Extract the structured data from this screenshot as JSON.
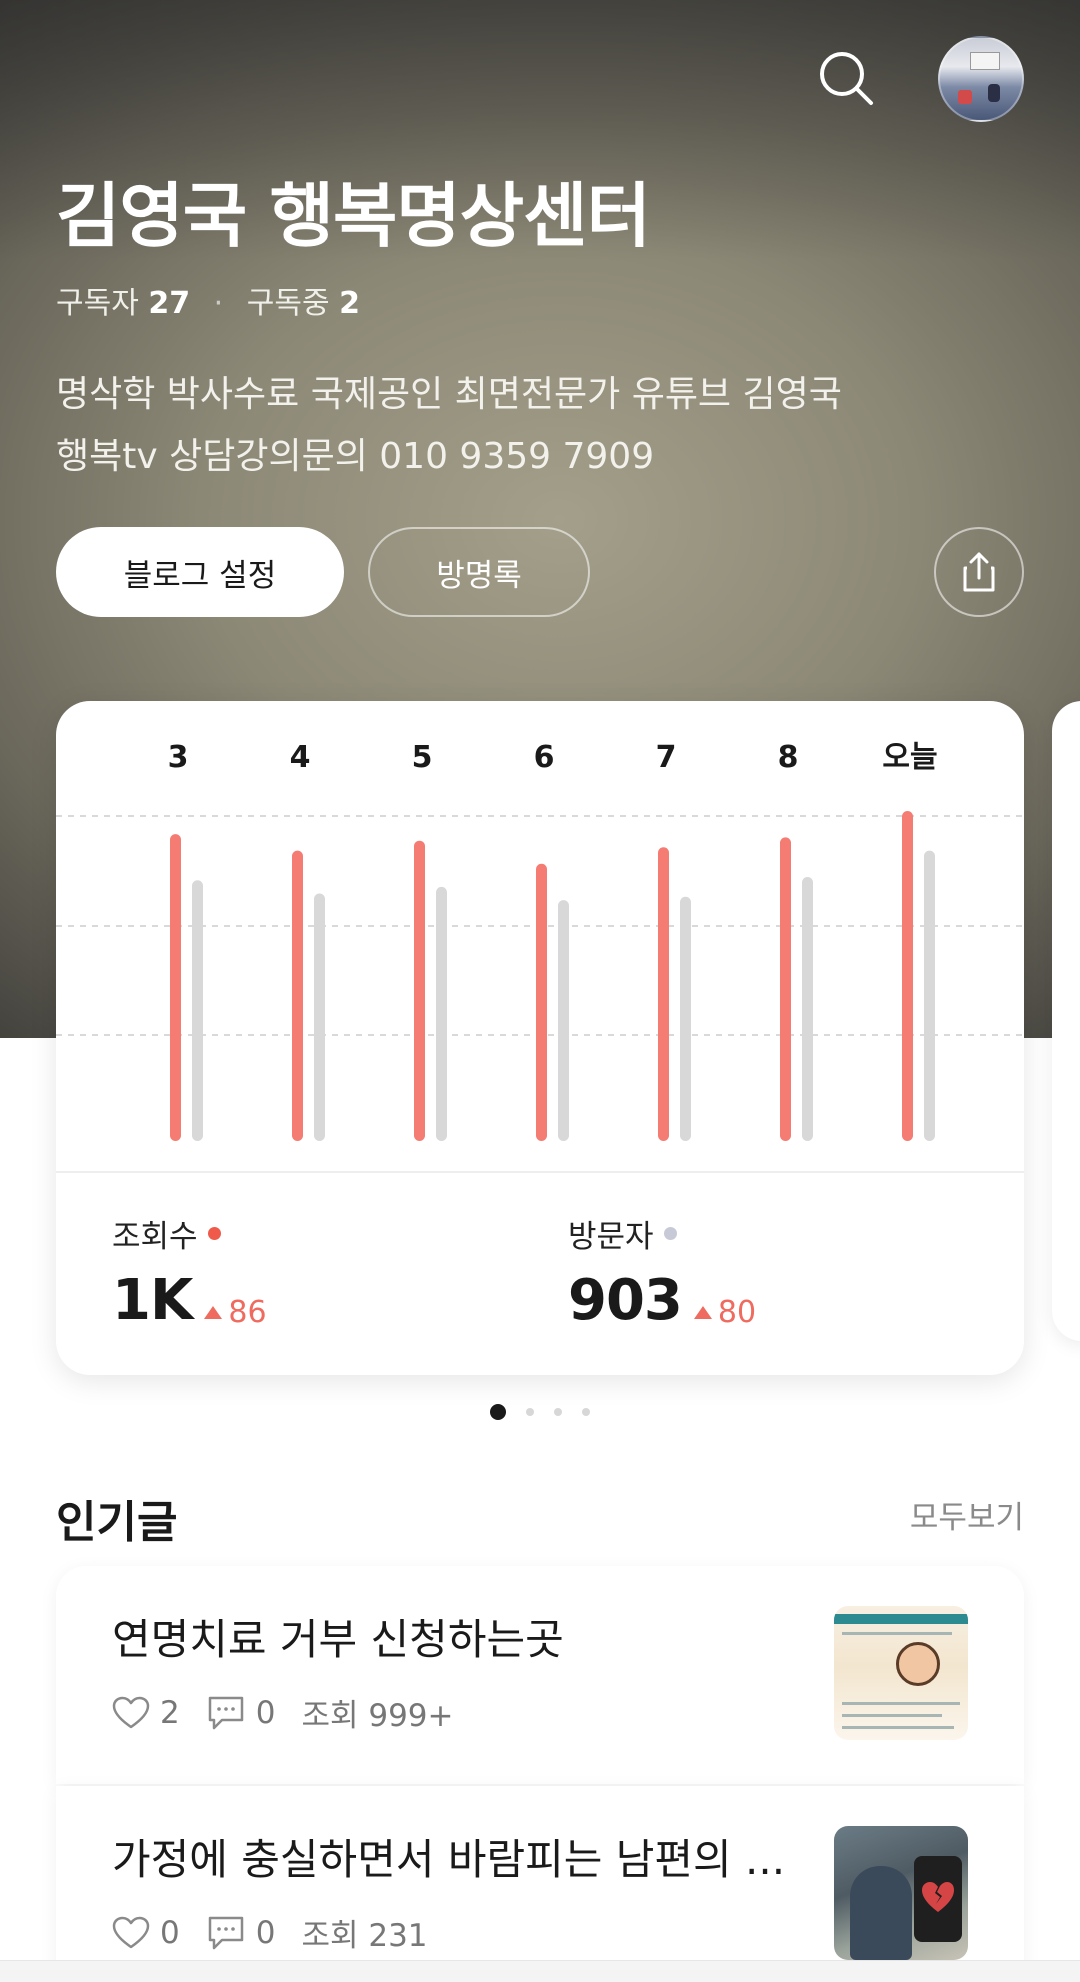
{
  "header": {
    "title": "김영국 행복명상센터",
    "subscribers_label": "구독자",
    "subscribers_count": "27",
    "subscribing_label": "구독중",
    "subscribing_count": "2",
    "description_line1": "명삭학 박사수료 국제공인 최면전문가 유튜브 김영국",
    "description_line2": "행복tv 상담강의문의 010 9359 7909",
    "icons": [
      "search-icon",
      "avatar",
      "share-icon"
    ]
  },
  "actions": {
    "blog_settings": "블로그 설정",
    "guestbook": "방명록"
  },
  "stats_card": {
    "views_label": "조회수",
    "views_value": "1K",
    "views_delta": "86",
    "visitors_label": "방문자",
    "visitors_value": "903",
    "visitors_delta": "80",
    "colors": {
      "views": "#f47c72",
      "visitors": "#d8d8d8",
      "delta": "#ef6b5f"
    }
  },
  "chart_data": {
    "type": "bar",
    "categories": [
      "3",
      "4",
      "5",
      "6",
      "7",
      "8",
      "오늘"
    ],
    "series": [
      {
        "name": "조회수",
        "values": [
          0.93,
          0.88,
          0.91,
          0.84,
          0.89,
          0.92,
          1.0
        ]
      },
      {
        "name": "방문자",
        "values": [
          0.79,
          0.75,
          0.77,
          0.73,
          0.74,
          0.8,
          0.88
        ]
      }
    ],
    "grid": true,
    "value_scale": "relative (no y-axis printed)"
  },
  "pager": {
    "count": 4,
    "active": 0
  },
  "popular": {
    "title": "인기글",
    "see_all": "모두보기",
    "posts": [
      {
        "title": "연명치료 거부 신청하는곳",
        "likes": "2",
        "comments": "0",
        "views": "조회 999+"
      },
      {
        "title": "가정에 충실하면서 바람피는 남편의 ...",
        "likes": "0",
        "comments": "0",
        "views": "조회 231"
      }
    ]
  }
}
